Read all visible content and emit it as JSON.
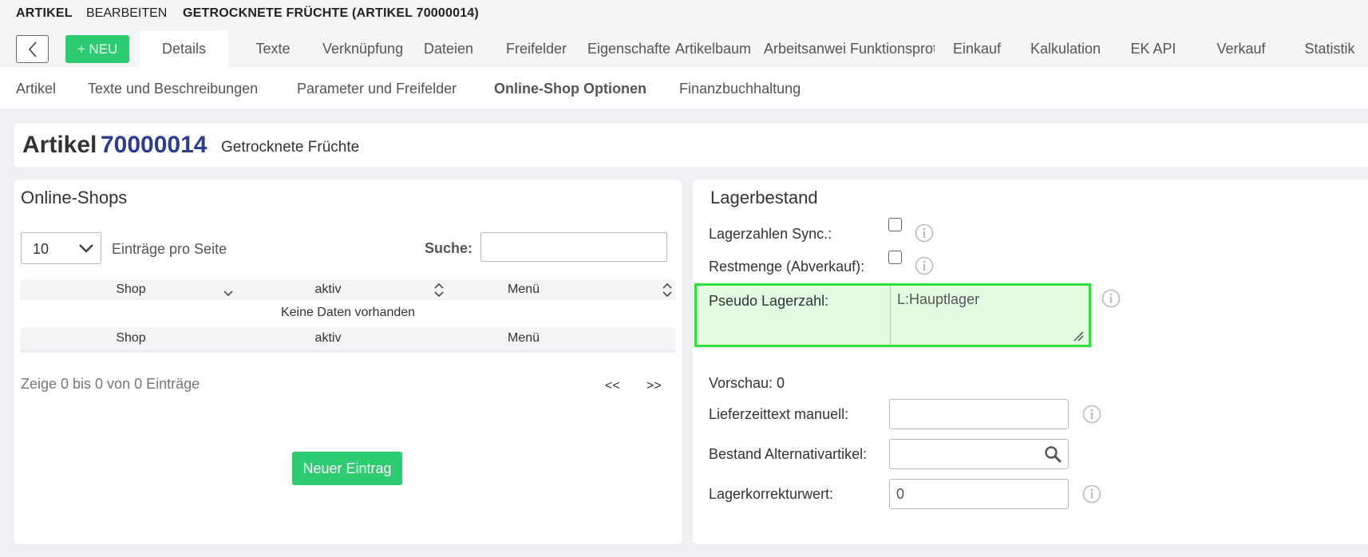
{
  "titlebar": {
    "section": "ARTIKEL",
    "action": "BEARBEITEN",
    "title": "GETROCKNETE FRÜCHTE (ARTIKEL 70000014)"
  },
  "toolbar": {
    "new_label": "+ NEU"
  },
  "tabs": [
    {
      "label": "Details",
      "active": true
    },
    {
      "label": "Texte"
    },
    {
      "label": "Verknüpfung"
    },
    {
      "label": "Dateien"
    },
    {
      "label": "Freifelder"
    },
    {
      "label": "Eigenschaften"
    },
    {
      "label": "Artikelbaum"
    },
    {
      "label": "Arbeitsanweisungen"
    },
    {
      "label": "Funktionsprotokoll"
    },
    {
      "label": "Einkauf"
    },
    {
      "label": "Kalkulation"
    },
    {
      "label": "EK API"
    },
    {
      "label": "Verkauf"
    },
    {
      "label": "Statistik"
    }
  ],
  "subtabs": [
    {
      "label": "Artikel"
    },
    {
      "label": "Texte und Beschreibungen"
    },
    {
      "label": "Parameter und Freifelder"
    },
    {
      "label": "Online-Shop Optionen",
      "active": true
    },
    {
      "label": "Finanzbuchhaltung"
    }
  ],
  "article": {
    "label": "Artikel",
    "number": "70000014",
    "name": "Getrocknete Früchte"
  },
  "online_shops": {
    "title": "Online-Shops",
    "page_size": "10",
    "page_size_label": "Einträge pro Seite",
    "search_label": "Suche:",
    "columns": [
      "Shop",
      "aktiv",
      "Menü"
    ],
    "empty_text": "Keine Daten vorhanden",
    "info_text": "Zeige 0 bis 0 von 0 Einträge",
    "prev": "<<",
    "next": ">>",
    "new_entry": "Neuer Eintrag"
  },
  "lagerbestand": {
    "title": "Lagerbestand",
    "sync_label": "Lagerzahlen Sync.:",
    "restmenge_label": "Restmenge (Abverkauf):",
    "pseudo_label": "Pseudo Lagerzahl:",
    "pseudo_value": "L:Hauptlager",
    "preview": "Vorschau: 0",
    "lieferzeit_label": "Lieferzeittext manuell:",
    "lieferzeit_value": "",
    "alternativ_label": "Bestand Alternativartikel:",
    "alternativ_value": "",
    "korrektur_label": "Lagerkorrekturwert:",
    "korrektur_value": "0"
  },
  "colors": {
    "accent_green": "#2ecc71",
    "highlight_border": "#31e03a",
    "article_number": "#2c3e91"
  }
}
